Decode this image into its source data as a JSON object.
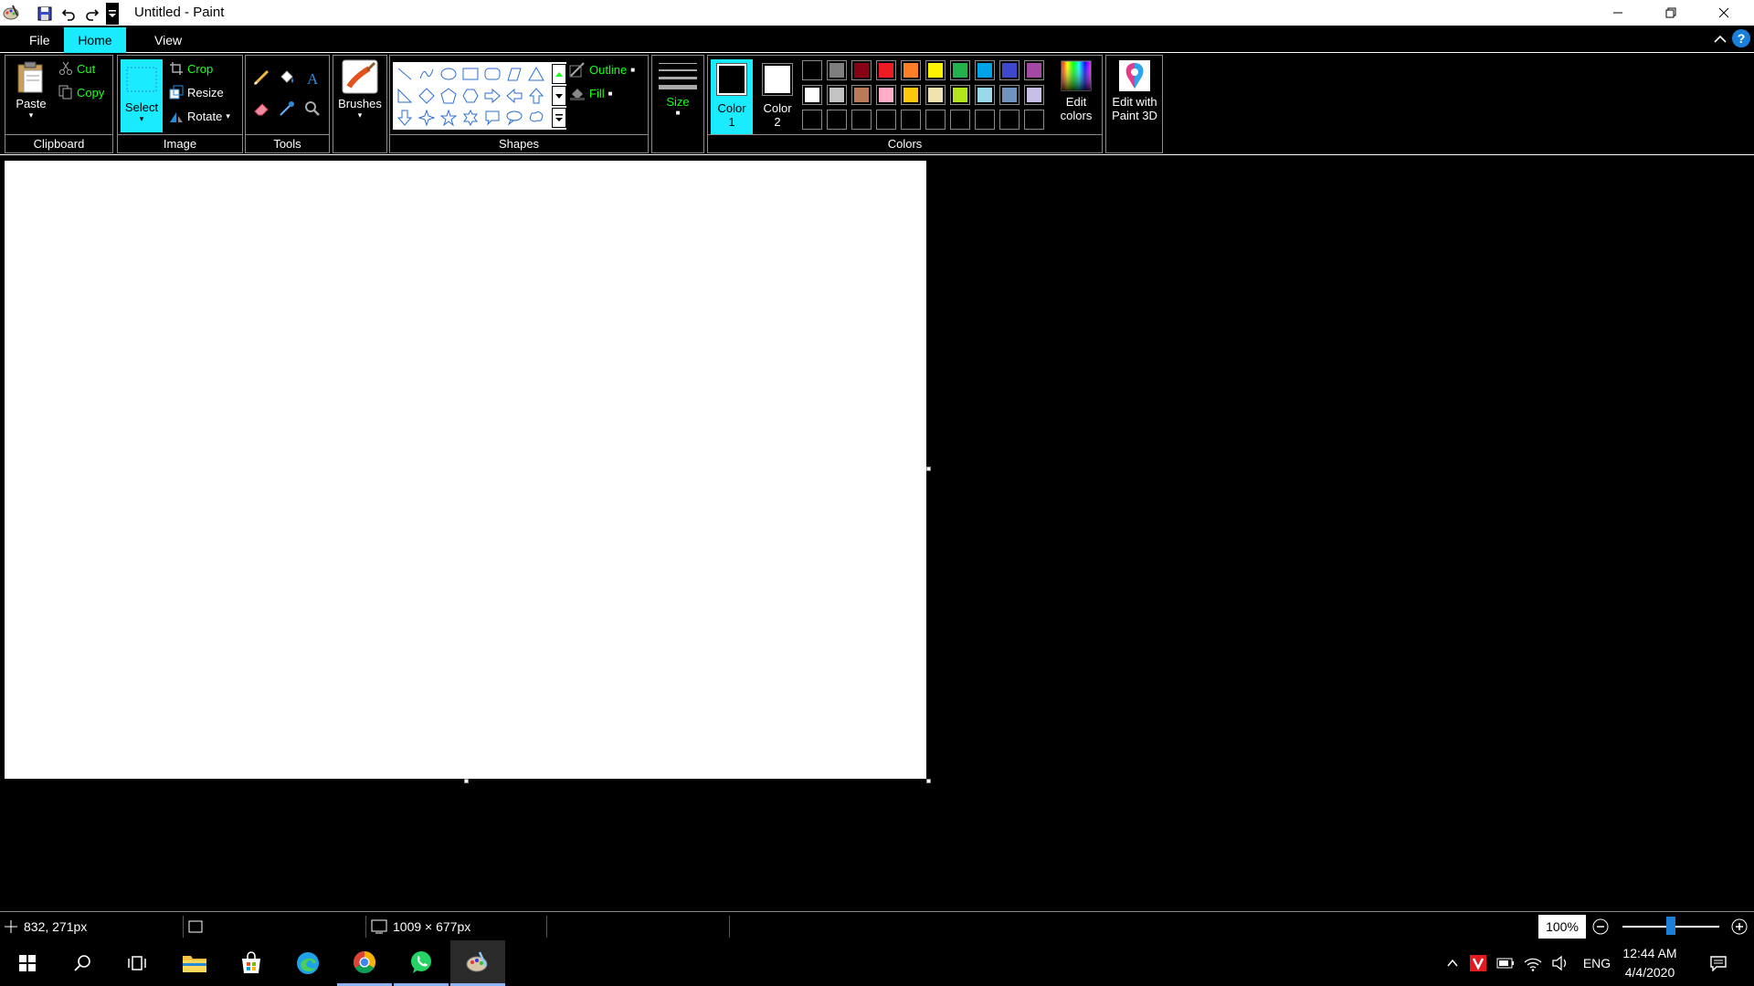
{
  "window": {
    "title": "Untitled - Paint"
  },
  "tabs": {
    "file": "File",
    "home": "Home",
    "view": "View"
  },
  "help_label": "?",
  "ribbon": {
    "clipboard": {
      "group_label": "Clipboard",
      "paste": "Paste",
      "cut": "Cut",
      "copy": "Copy"
    },
    "image": {
      "group_label": "Image",
      "select": "Select",
      "crop": "Crop",
      "resize": "Resize",
      "rotate": "Rotate"
    },
    "tools": {
      "group_label": "Tools"
    },
    "brushes": {
      "label": "Brushes"
    },
    "shapes": {
      "group_label": "Shapes",
      "outline": "Outline",
      "fill": "Fill"
    },
    "size": {
      "label": "Size"
    },
    "colors": {
      "group_label": "Colors",
      "color1_line1": "Color",
      "color1_line2": "1",
      "color2_line1": "Color",
      "color2_line2": "2",
      "edit_colors_line1": "Edit",
      "edit_colors_line2": "colors",
      "color1_value": "#000000",
      "color2_value": "#ffffff",
      "palette_row1": [
        "#000000",
        "#7f7f7f",
        "#880015",
        "#ed1c24",
        "#ff7f27",
        "#fff200",
        "#22b14c",
        "#00a2e8",
        "#3f48cc",
        "#a349a4"
      ],
      "palette_row2": [
        "#ffffff",
        "#c3c3c3",
        "#b97a57",
        "#ffaec9",
        "#ffc90e",
        "#efe4b0",
        "#b5e61d",
        "#99d9ea",
        "#7092be",
        "#c8bfe7"
      ]
    },
    "paint3d": {
      "line1": "Edit with",
      "line2": "Paint 3D"
    }
  },
  "status": {
    "cursor_pos": "832, 271px",
    "canvas_size": "1009 × 677px",
    "zoom": "100%"
  },
  "taskbar": {
    "tray_lang": "ENG",
    "time": "12:44 AM",
    "date": "4/4/2020"
  }
}
